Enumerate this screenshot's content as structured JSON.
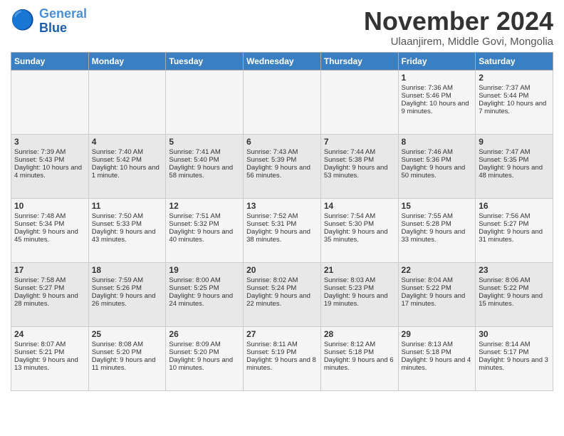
{
  "logo": {
    "line1": "General",
    "line2": "Blue"
  },
  "title": "November 2024",
  "subtitle": "Ulaanjirem, Middle Govi, Mongolia",
  "weekdays": [
    "Sunday",
    "Monday",
    "Tuesday",
    "Wednesday",
    "Thursday",
    "Friday",
    "Saturday"
  ],
  "weeks": [
    [
      {
        "day": "",
        "content": ""
      },
      {
        "day": "",
        "content": ""
      },
      {
        "day": "",
        "content": ""
      },
      {
        "day": "",
        "content": ""
      },
      {
        "day": "",
        "content": ""
      },
      {
        "day": "1",
        "content": "Sunrise: 7:36 AM\nSunset: 5:46 PM\nDaylight: 10 hours and 9 minutes."
      },
      {
        "day": "2",
        "content": "Sunrise: 7:37 AM\nSunset: 5:44 PM\nDaylight: 10 hours and 7 minutes."
      }
    ],
    [
      {
        "day": "3",
        "content": "Sunrise: 7:39 AM\nSunset: 5:43 PM\nDaylight: 10 hours and 4 minutes."
      },
      {
        "day": "4",
        "content": "Sunrise: 7:40 AM\nSunset: 5:42 PM\nDaylight: 10 hours and 1 minute."
      },
      {
        "day": "5",
        "content": "Sunrise: 7:41 AM\nSunset: 5:40 PM\nDaylight: 9 hours and 58 minutes."
      },
      {
        "day": "6",
        "content": "Sunrise: 7:43 AM\nSunset: 5:39 PM\nDaylight: 9 hours and 56 minutes."
      },
      {
        "day": "7",
        "content": "Sunrise: 7:44 AM\nSunset: 5:38 PM\nDaylight: 9 hours and 53 minutes."
      },
      {
        "day": "8",
        "content": "Sunrise: 7:46 AM\nSunset: 5:36 PM\nDaylight: 9 hours and 50 minutes."
      },
      {
        "day": "9",
        "content": "Sunrise: 7:47 AM\nSunset: 5:35 PM\nDaylight: 9 hours and 48 minutes."
      }
    ],
    [
      {
        "day": "10",
        "content": "Sunrise: 7:48 AM\nSunset: 5:34 PM\nDaylight: 9 hours and 45 minutes."
      },
      {
        "day": "11",
        "content": "Sunrise: 7:50 AM\nSunset: 5:33 PM\nDaylight: 9 hours and 43 minutes."
      },
      {
        "day": "12",
        "content": "Sunrise: 7:51 AM\nSunset: 5:32 PM\nDaylight: 9 hours and 40 minutes."
      },
      {
        "day": "13",
        "content": "Sunrise: 7:52 AM\nSunset: 5:31 PM\nDaylight: 9 hours and 38 minutes."
      },
      {
        "day": "14",
        "content": "Sunrise: 7:54 AM\nSunset: 5:30 PM\nDaylight: 9 hours and 35 minutes."
      },
      {
        "day": "15",
        "content": "Sunrise: 7:55 AM\nSunset: 5:28 PM\nDaylight: 9 hours and 33 minutes."
      },
      {
        "day": "16",
        "content": "Sunrise: 7:56 AM\nSunset: 5:27 PM\nDaylight: 9 hours and 31 minutes."
      }
    ],
    [
      {
        "day": "17",
        "content": "Sunrise: 7:58 AM\nSunset: 5:27 PM\nDaylight: 9 hours and 28 minutes."
      },
      {
        "day": "18",
        "content": "Sunrise: 7:59 AM\nSunset: 5:26 PM\nDaylight: 9 hours and 26 minutes."
      },
      {
        "day": "19",
        "content": "Sunrise: 8:00 AM\nSunset: 5:25 PM\nDaylight: 9 hours and 24 minutes."
      },
      {
        "day": "20",
        "content": "Sunrise: 8:02 AM\nSunset: 5:24 PM\nDaylight: 9 hours and 22 minutes."
      },
      {
        "day": "21",
        "content": "Sunrise: 8:03 AM\nSunset: 5:23 PM\nDaylight: 9 hours and 19 minutes."
      },
      {
        "day": "22",
        "content": "Sunrise: 8:04 AM\nSunset: 5:22 PM\nDaylight: 9 hours and 17 minutes."
      },
      {
        "day": "23",
        "content": "Sunrise: 8:06 AM\nSunset: 5:22 PM\nDaylight: 9 hours and 15 minutes."
      }
    ],
    [
      {
        "day": "24",
        "content": "Sunrise: 8:07 AM\nSunset: 5:21 PM\nDaylight: 9 hours and 13 minutes."
      },
      {
        "day": "25",
        "content": "Sunrise: 8:08 AM\nSunset: 5:20 PM\nDaylight: 9 hours and 11 minutes."
      },
      {
        "day": "26",
        "content": "Sunrise: 8:09 AM\nSunset: 5:20 PM\nDaylight: 9 hours and 10 minutes."
      },
      {
        "day": "27",
        "content": "Sunrise: 8:11 AM\nSunset: 5:19 PM\nDaylight: 9 hours and 8 minutes."
      },
      {
        "day": "28",
        "content": "Sunrise: 8:12 AM\nSunset: 5:18 PM\nDaylight: 9 hours and 6 minutes."
      },
      {
        "day": "29",
        "content": "Sunrise: 8:13 AM\nSunset: 5:18 PM\nDaylight: 9 hours and 4 minutes."
      },
      {
        "day": "30",
        "content": "Sunrise: 8:14 AM\nSunset: 5:17 PM\nDaylight: 9 hours and 3 minutes."
      }
    ]
  ]
}
